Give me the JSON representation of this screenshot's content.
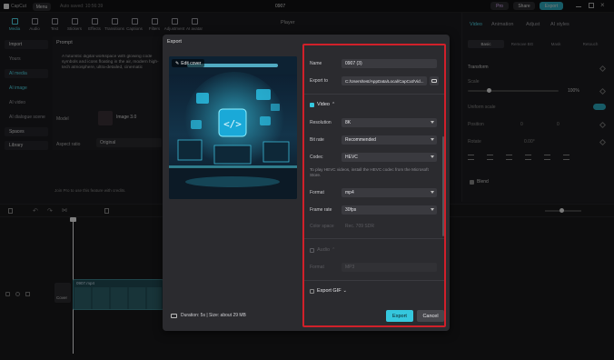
{
  "titlebar": {
    "app_name": "CapCut",
    "menu_label": "Menu",
    "autosave_text": "Auto saved: 10:56:39",
    "project_name": "0907",
    "pro_label": "Pro",
    "share_label": "Share",
    "export_label": "Export"
  },
  "toolbar": {
    "items": [
      {
        "label": "Media",
        "icon": "media-icon",
        "active": true
      },
      {
        "label": "Audio",
        "icon": "audio-icon"
      },
      {
        "label": "Text",
        "icon": "text-icon"
      },
      {
        "label": "Stickers",
        "icon": "sticker-icon"
      },
      {
        "label": "Effects",
        "icon": "effects-icon"
      },
      {
        "label": "Transitions",
        "icon": "transitions-icon"
      },
      {
        "label": "Captions",
        "icon": "captions-icon"
      },
      {
        "label": "Filters",
        "icon": "filters-icon"
      },
      {
        "label": "Adjustment",
        "icon": "adjustment-icon"
      },
      {
        "label": "AI avatar",
        "icon": "ai-avatar-icon"
      }
    ]
  },
  "left_nav": {
    "items": [
      "Import",
      "Yours",
      "AI media",
      "AI image",
      "AI video",
      "AI dialogue scene",
      "Spaces",
      "Library"
    ]
  },
  "prompt_panel": {
    "title": "Prompt",
    "text": "A futuristic digital workspace with glowing code symbols and icons floating in the air, modern high-tech atmosphere, ultra-detailed, cinematic",
    "model_label": "Model",
    "model_value": "Image 3.0",
    "aspect_label": "Aspect ratio",
    "aspect_value": "Original",
    "pro_notice": "Join Pro to use this feature with credits."
  },
  "player": {
    "title": "Player"
  },
  "right_panel": {
    "tabs": [
      "Video",
      "Animation",
      "Adjust",
      "AI styles"
    ],
    "subtabs": [
      "Basic",
      "Remove BG",
      "Mask",
      "Retouch"
    ],
    "transform_label": "Transform",
    "scale_label": "Scale",
    "scale_value": "100%",
    "uniform_label": "Uniform scale",
    "position_label": "Position",
    "position_x": "0",
    "position_y": "0",
    "rotate_label": "Rotate",
    "rotate_value": "0.00°",
    "blend_label": "Blend"
  },
  "timeline": {
    "clip_name": "0907.mp4",
    "cover_label": "Cover"
  },
  "dialog": {
    "title": "Export",
    "edit_cover": "Edit cover",
    "name_label": "Name",
    "name_value": "0907 (3)",
    "export_to_label": "Export to",
    "export_to_value": "C:/Users/test/AppData/Local/CapCut/Vid...",
    "video_section": "Video",
    "resolution_label": "Resolution",
    "resolution_value": "8K",
    "bitrate_label": "Bit rate",
    "bitrate_value": "Recommended",
    "codec_label": "Codec",
    "codec_value": "HEVC",
    "hevc_note": "To play HEVC videos, install the HEVC codec from the Microsoft Store.",
    "format_label": "Format",
    "format_value": "mp4",
    "framerate_label": "Frame rate",
    "framerate_value": "30fps",
    "colorspace_label": "Color space",
    "colorspace_value": "Rec. 709 SDR",
    "audio_section": "Audio",
    "audio_format_label": "Format",
    "audio_format_value": "MP3",
    "gif_section": "Export GIF",
    "duration_text": "Duration: 5s | Size: about 29 MB",
    "export_button": "Export",
    "cancel_button": "Cancel",
    "accent_color": "#35c7dd",
    "highlight_color": "#d0202a"
  }
}
